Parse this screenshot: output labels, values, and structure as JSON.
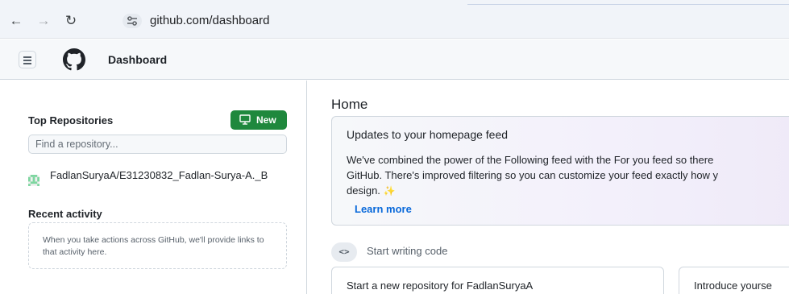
{
  "browser": {
    "url": "github.com/dashboard"
  },
  "header": {
    "title": "Dashboard"
  },
  "sidebar": {
    "top_repositories_title": "Top Repositories",
    "new_button_label": "New",
    "search_placeholder": "Find a repository...",
    "repositories": [
      {
        "name": "FadlanSuryaA/E31230832_Fadlan-Surya-A._B"
      }
    ],
    "recent_activity_title": "Recent activity",
    "recent_activity_empty_text": "When you take actions across GitHub, we'll provide links to that activity here."
  },
  "main": {
    "home_title": "Home",
    "updates_card": {
      "title": "Updates to your homepage feed",
      "body_line1": "We've combined the power of the Following feed with the For you feed so there",
      "body_line2": "GitHub. There's improved filtering so you can customize your feed exactly how y",
      "body_line3": "design.",
      "learn_more_label": "Learn more"
    },
    "start_writing_code_label": "Start writing code",
    "code_icon_glyph": "<>",
    "cards": {
      "new_repo_title": "Start a new repository for FadlanSuryaA",
      "introduce_title": "Introduce yourse"
    }
  },
  "colors": {
    "new_button_bg": "#1f883d",
    "link": "#0969da",
    "sparkle": "#e3b341"
  },
  "icons": {
    "back": "arrow-left-icon",
    "forward": "arrow-right-icon",
    "reload": "reload-icon",
    "site_info": "site-info-icon",
    "menu": "hamburger-icon",
    "logo": "github-logo-icon",
    "new_repo": "repo-icon",
    "avatar": "identicon-icon",
    "sparkle": "sparkle-icon",
    "code": "code-icon"
  }
}
